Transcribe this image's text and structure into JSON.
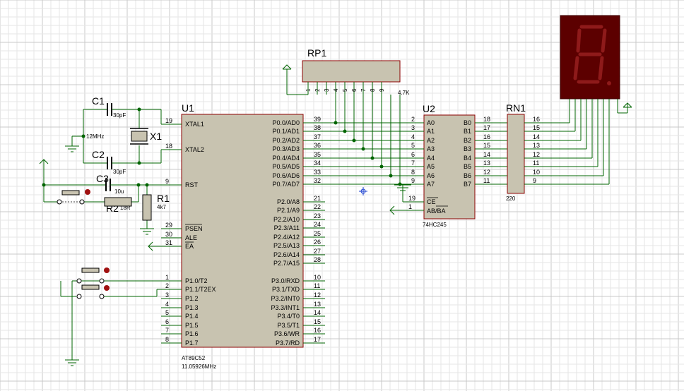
{
  "colors": {
    "wire": "#006400",
    "body_fill": "#c8c3b0",
    "body_stroke": "#8b0000",
    "display_bg": "#5c0000",
    "segment_off": "#8e1a1a",
    "grid_major": "#c8c8c8",
    "grid_minor": "#e6e6e6",
    "junction": "#006400",
    "button_red": "#a01010"
  },
  "icons": [
    "ground-icon",
    "power-icon",
    "junction-dot",
    "marker-cross-icon"
  ],
  "u1": {
    "ref": "U1",
    "part": "AT89C52",
    "freq": "11.05926MHz",
    "left_pins": [
      {
        "num": "19",
        "name": "XTAL1"
      },
      {
        "num": "18",
        "name": "XTAL2"
      },
      {
        "num": "9",
        "name": "RST"
      },
      {
        "num": "29",
        "name": "PSEN"
      },
      {
        "num": "30",
        "name": "ALE"
      },
      {
        "num": "31",
        "name": "EA"
      },
      {
        "num": "1",
        "name": "P1.0/T2"
      },
      {
        "num": "2",
        "name": "P1.1/T2EX"
      },
      {
        "num": "3",
        "name": "P1.2"
      },
      {
        "num": "4",
        "name": "P1.3"
      },
      {
        "num": "5",
        "name": "P1.4"
      },
      {
        "num": "6",
        "name": "P1.5"
      },
      {
        "num": "7",
        "name": "P1.6"
      },
      {
        "num": "8",
        "name": "P1.7"
      }
    ],
    "right_pins": [
      {
        "num": "39",
        "name": "P0.0/AD0"
      },
      {
        "num": "38",
        "name": "P0.1/AD1"
      },
      {
        "num": "37",
        "name": "P0.2/AD2"
      },
      {
        "num": "36",
        "name": "P0.3/AD3"
      },
      {
        "num": "35",
        "name": "P0.4/AD4"
      },
      {
        "num": "34",
        "name": "P0.5/AD5"
      },
      {
        "num": "33",
        "name": "P0.6/AD6"
      },
      {
        "num": "32",
        "name": "P0.7/AD7"
      },
      {
        "num": "21",
        "name": "P2.0/A8"
      },
      {
        "num": "22",
        "name": "P2.1/A9"
      },
      {
        "num": "23",
        "name": "P2.2/A10"
      },
      {
        "num": "24",
        "name": "P2.3/A11"
      },
      {
        "num": "25",
        "name": "P2.4/A12"
      },
      {
        "num": "26",
        "name": "P2.5/A13"
      },
      {
        "num": "27",
        "name": "P2.6/A14"
      },
      {
        "num": "28",
        "name": "P2.7/A15"
      },
      {
        "num": "10",
        "name": "P3.0/RXD"
      },
      {
        "num": "11",
        "name": "P3.1/TXD"
      },
      {
        "num": "12",
        "name": "P3.2/INT0"
      },
      {
        "num": "13",
        "name": "P3.3/INT1"
      },
      {
        "num": "14",
        "name": "P3.4/T0"
      },
      {
        "num": "15",
        "name": "P3.5/T1"
      },
      {
        "num": "16",
        "name": "P3.6/WR"
      },
      {
        "num": "17",
        "name": "P3.7/RD"
      }
    ]
  },
  "u2": {
    "ref": "U2",
    "part": "74HC245",
    "a_pins": [
      {
        "num": "2",
        "name": "A0"
      },
      {
        "num": "3",
        "name": "A1"
      },
      {
        "num": "4",
        "name": "A2"
      },
      {
        "num": "5",
        "name": "A3"
      },
      {
        "num": "6",
        "name": "A4"
      },
      {
        "num": "7",
        "name": "A5"
      },
      {
        "num": "8",
        "name": "A6"
      },
      {
        "num": "9",
        "name": "A7"
      }
    ],
    "b_pins": [
      {
        "num": "18",
        "name": "B0"
      },
      {
        "num": "17",
        "name": "B1"
      },
      {
        "num": "16",
        "name": "B2"
      },
      {
        "num": "15",
        "name": "B3"
      },
      {
        "num": "14",
        "name": "B4"
      },
      {
        "num": "13",
        "name": "B5"
      },
      {
        "num": "12",
        "name": "B6"
      },
      {
        "num": "11",
        "name": "B7"
      }
    ],
    "ce": {
      "num": "19",
      "name": "CE"
    },
    "ab": {
      "num": "1",
      "name": "AB/BA"
    }
  },
  "rp1": {
    "ref": "RP1",
    "value": "4.7K",
    "pins": [
      "1",
      "2",
      "3",
      "4",
      "5",
      "6",
      "7",
      "8",
      "9"
    ]
  },
  "rn1": {
    "ref": "RN1",
    "value": "220",
    "pins": [
      "16",
      "15",
      "14",
      "13",
      "12",
      "11",
      "10",
      "9"
    ]
  },
  "c1": {
    "ref": "C1",
    "value": "30pF"
  },
  "c2": {
    "ref": "C2",
    "value": "30pF"
  },
  "c3": {
    "ref": "C3",
    "value": "10u"
  },
  "x1": {
    "ref": "X1",
    "value": "12MHz"
  },
  "r1": {
    "ref": "R1",
    "value": "4k7"
  },
  "r2": {
    "ref": "R2",
    "value": "18R"
  }
}
